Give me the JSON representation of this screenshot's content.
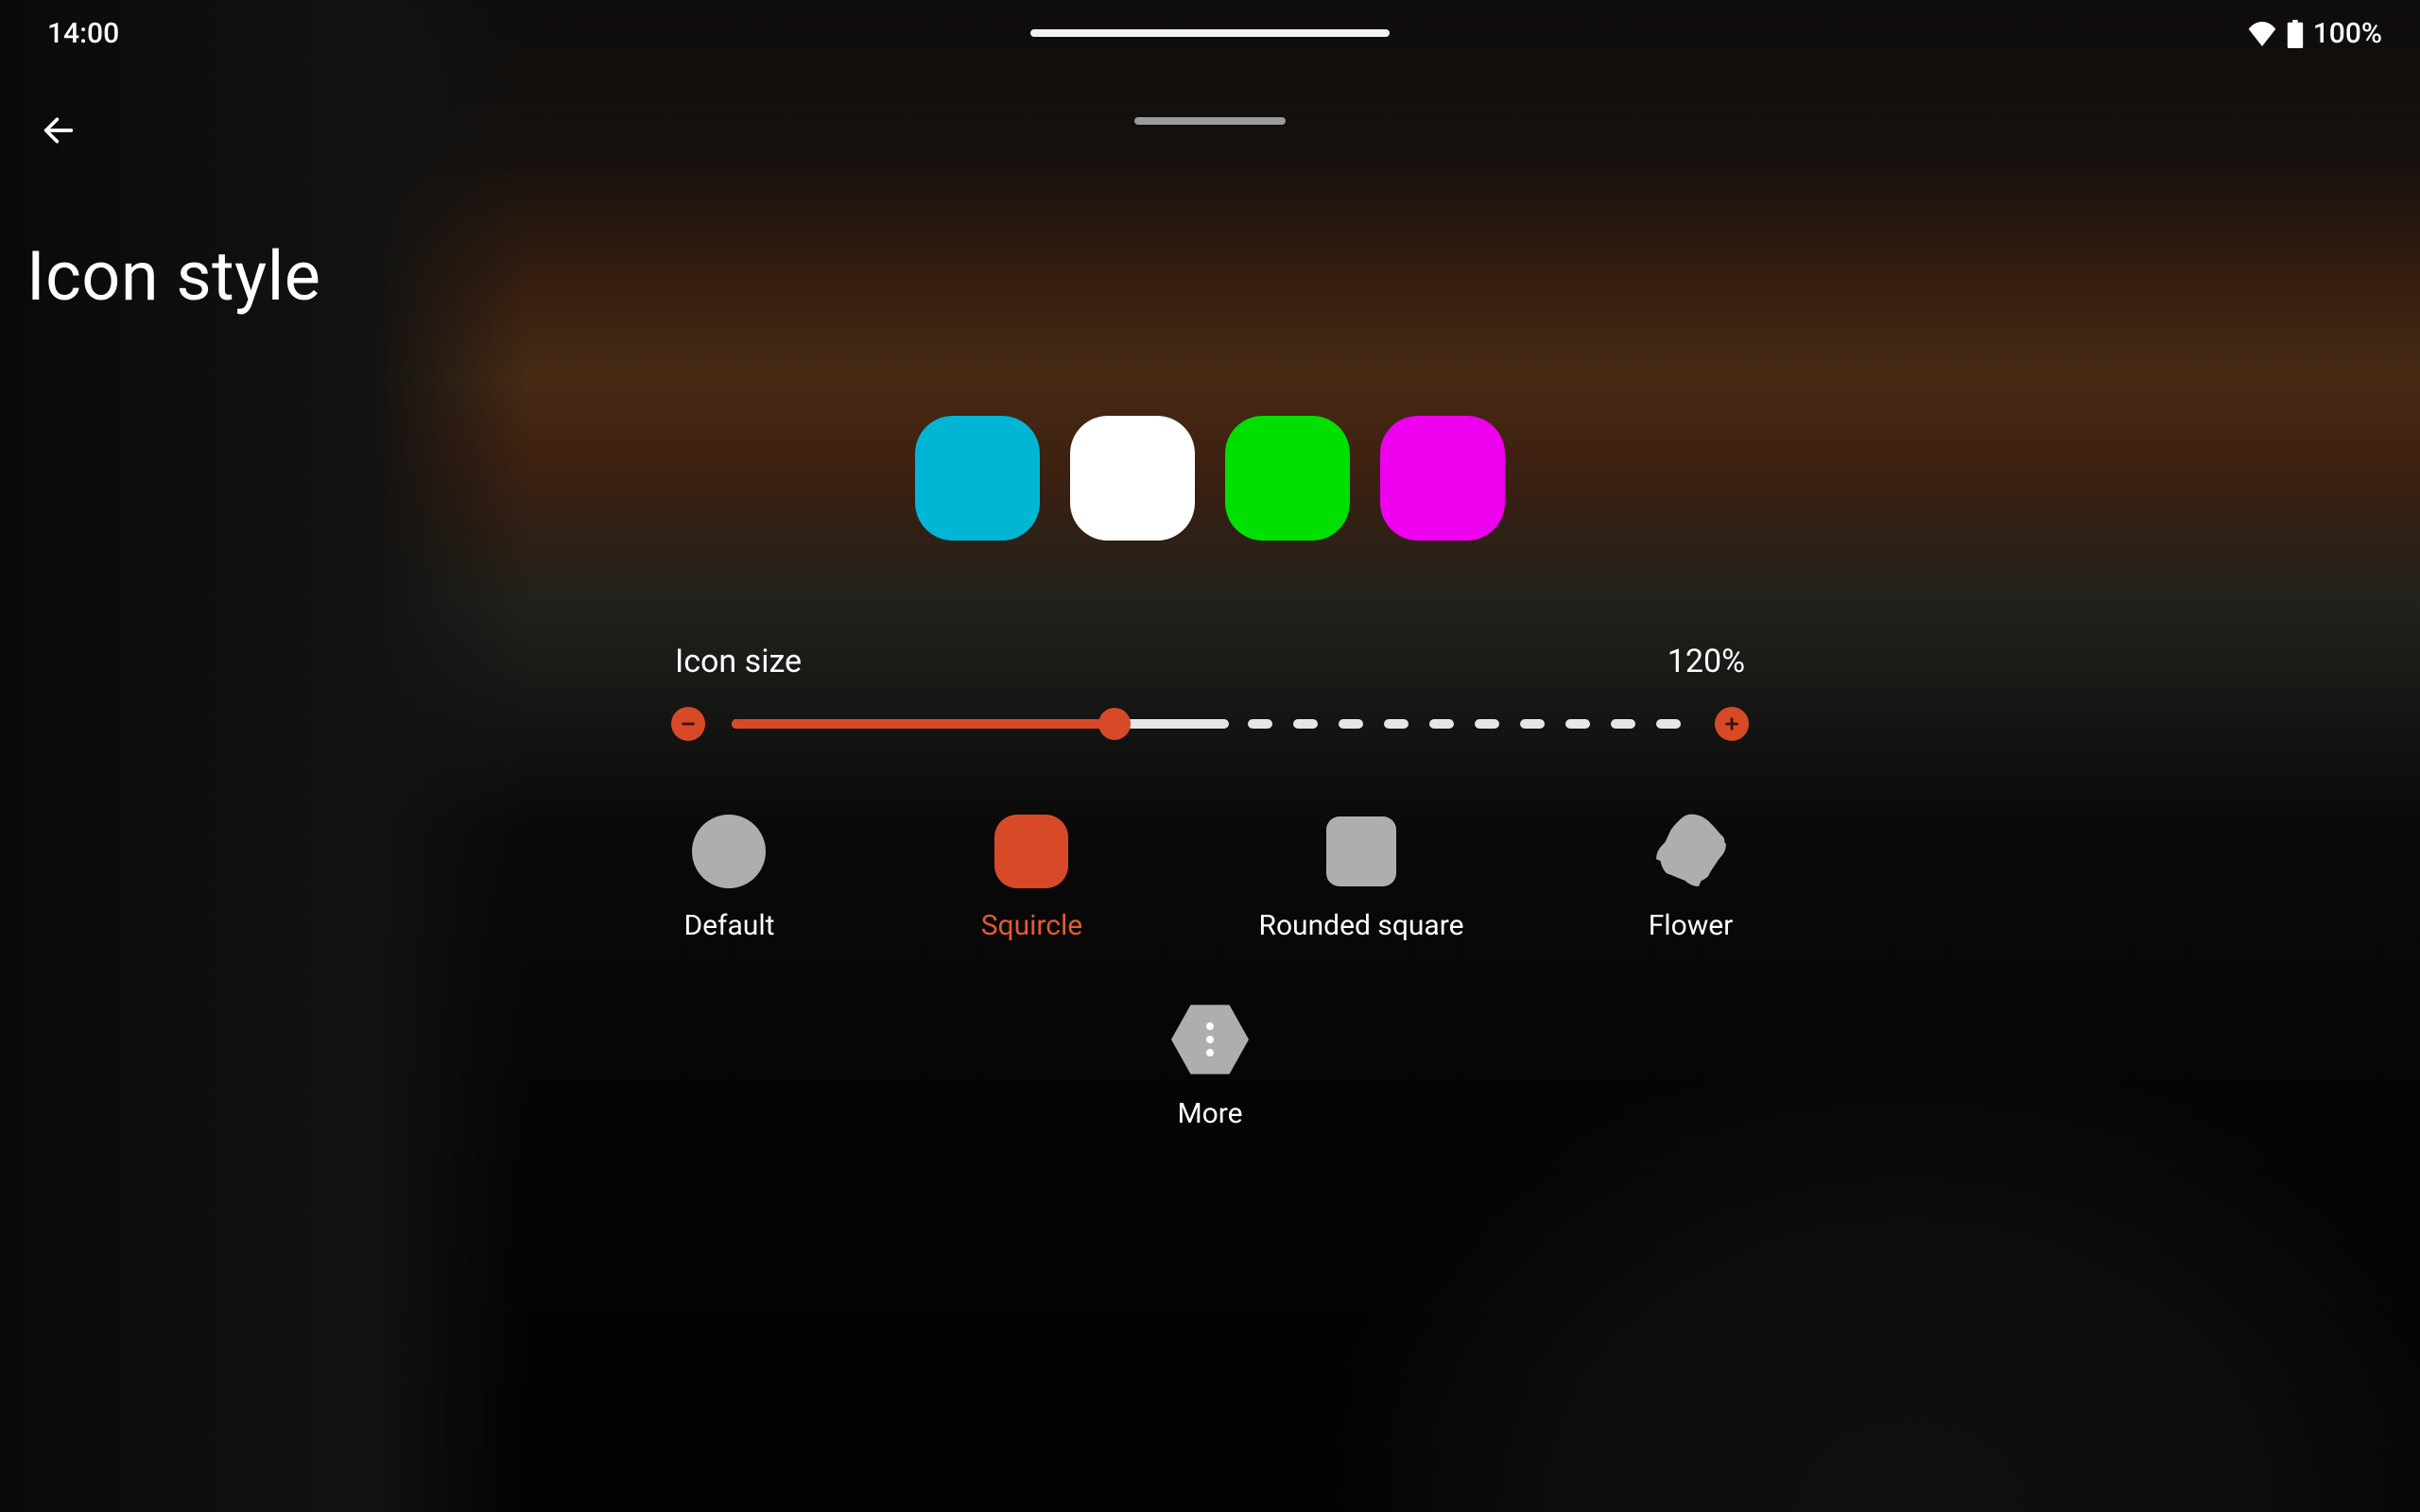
{
  "status": {
    "time": "14:00",
    "battery_pct": "100%"
  },
  "title": "Icon style",
  "preview_colors": [
    "#00b6d4",
    "#ffffff",
    "#00e000",
    "#ee00ee"
  ],
  "icon_size": {
    "label": "Icon size",
    "value": "120%",
    "slider_fill_pct": 40,
    "slider_solid_pct": 52
  },
  "shapes": {
    "default": "Default",
    "squircle": "Squircle",
    "rounded_square": "Rounded square",
    "flower": "Flower",
    "more": "More",
    "selected": "squircle"
  },
  "colors": {
    "accent": "#d84a27"
  }
}
